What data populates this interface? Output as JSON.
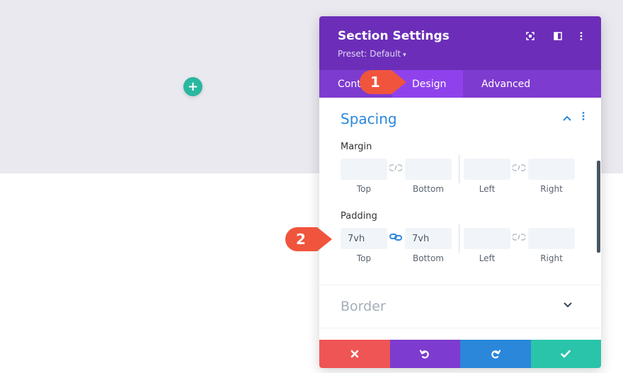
{
  "panel": {
    "title": "Section Settings",
    "preset_label": "Preset: Default",
    "header_icons": [
      "fullscreen-icon",
      "split-view-icon",
      "more-vertical-icon"
    ]
  },
  "tabs": [
    {
      "label": "Cont"
    },
    {
      "label": "Design"
    },
    {
      "label": "Advanced"
    }
  ],
  "spacing": {
    "title": "Spacing",
    "margin": {
      "label": "Margin",
      "top": "",
      "bottom": "",
      "left": "",
      "right": "",
      "linked_top_bottom": false,
      "linked_left_right": false
    },
    "padding": {
      "label": "Padding",
      "top": "7vh",
      "bottom": "7vh",
      "left": "",
      "right": "",
      "linked_top_bottom": true,
      "linked_left_right": false
    },
    "side_labels": [
      "Top",
      "Bottom",
      "Left",
      "Right"
    ]
  },
  "border": {
    "title": "Border"
  },
  "markers": [
    "1",
    "2"
  ],
  "footer": {
    "buttons": [
      {
        "name": "cancel",
        "icon": "close-icon",
        "color": "#ef5555"
      },
      {
        "name": "undo",
        "icon": "undo-icon",
        "color": "#7e3bd0"
      },
      {
        "name": "redo",
        "icon": "redo-icon",
        "color": "#2b87da"
      },
      {
        "name": "save",
        "icon": "check-icon",
        "color": "#29c4a9"
      }
    ]
  },
  "colors": {
    "header": "#6c2eb9",
    "tabs": "#7e3bd0",
    "active_tab": "#8f42ec",
    "accent_blue": "#2b87da",
    "add_button": "#2ab7a0",
    "marker": "#f0543c"
  }
}
